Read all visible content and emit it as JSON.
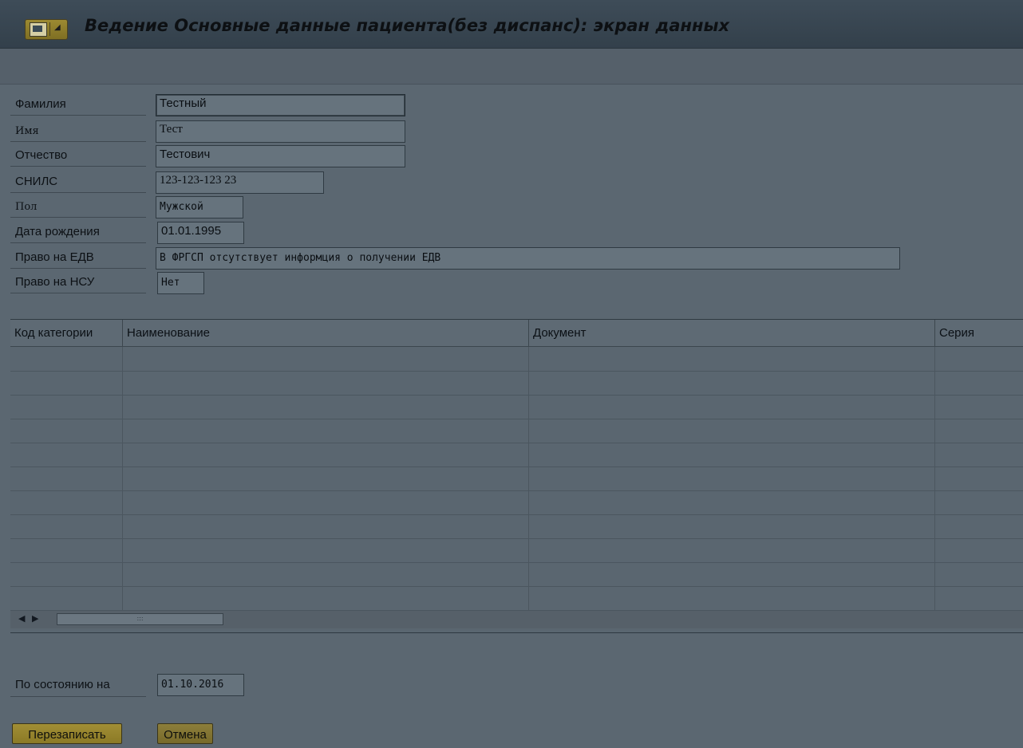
{
  "window": {
    "title": "Ведение Основные данные пациента(без диспанс): экран данных",
    "menu_button_icon": "sap-menu-icon",
    "dropdown_icon": "dropdown-arrow-icon"
  },
  "form": {
    "surname": {
      "label": "Фамилия",
      "value": "Тестный"
    },
    "name": {
      "label": "Имя",
      "value": "Тест"
    },
    "patronymic": {
      "label": "Отчество",
      "value": "Тестович"
    },
    "snils": {
      "label": "СНИЛС",
      "value": "123-123-123 23"
    },
    "gender": {
      "label": "Пол",
      "value": "Мужской"
    },
    "birthdate": {
      "label": "Дата рождения",
      "value": "01.01.1995"
    },
    "edv_right": {
      "label": "Право на ЕДВ",
      "value": "В ФРГСП отсутствует информция о получении ЕДВ"
    },
    "nsu_right": {
      "label": "Право на НСУ",
      "value": "Нет"
    }
  },
  "table": {
    "columns": [
      "Код категории",
      "Наименование",
      "Документ",
      "Серия"
    ],
    "rows": [
      [
        "",
        "",
        "",
        ""
      ],
      [
        "",
        "",
        "",
        ""
      ],
      [
        "",
        "",
        "",
        ""
      ],
      [
        "",
        "",
        "",
        ""
      ],
      [
        "",
        "",
        "",
        ""
      ],
      [
        "",
        "",
        "",
        ""
      ],
      [
        "",
        "",
        "",
        ""
      ],
      [
        "",
        "",
        "",
        ""
      ],
      [
        "",
        "",
        "",
        ""
      ],
      [
        "",
        "",
        "",
        ""
      ],
      [
        "",
        "",
        "",
        ""
      ]
    ],
    "scroll_left_icon": "arrow-left-icon",
    "scroll_right_icon": "arrow-right-icon"
  },
  "footer": {
    "as_of": {
      "label": "По состоянию на",
      "value": "01.10.2016"
    }
  },
  "buttons": {
    "save_label": "Перезаписать",
    "cancel_label": "Отмена"
  },
  "colors": {
    "button_accent": "#a18e35",
    "focus_corner": "#7a1d1d"
  }
}
